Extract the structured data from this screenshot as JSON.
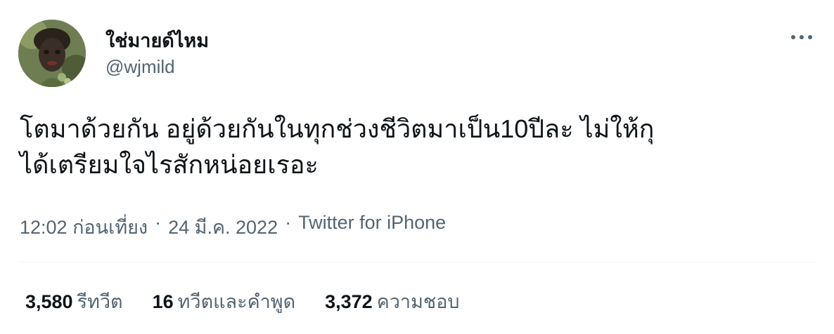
{
  "author": {
    "display_name": "ใช่มายด์ไหม",
    "handle": "@wjmild"
  },
  "tweet": {
    "text_line1": "โตมาด้วยกัน อยู่ด้วยกันในทุกช่วงชีวิตมาเป็น10ปีละ ไม่ให้กุ",
    "text_line2": "ได้เตรียมใจไรสักหน่อยเรอะ"
  },
  "meta": {
    "time": "12:02 ก่อนเที่ยง",
    "separator": "·",
    "date": "24 มี.ค. 2022",
    "source": "Twitter for iPhone"
  },
  "stats": [
    {
      "count": "3,580",
      "label": "รีทวีต"
    },
    {
      "count": "16",
      "label": "ทวีตและคำพูด"
    },
    {
      "count": "3,372",
      "label": "ความชอบ"
    }
  ],
  "icons": {
    "more": "more-horizontal-icon"
  },
  "colors": {
    "primary_text": "#0f1419",
    "secondary_text": "#536471",
    "divider": "#eff3f4"
  }
}
